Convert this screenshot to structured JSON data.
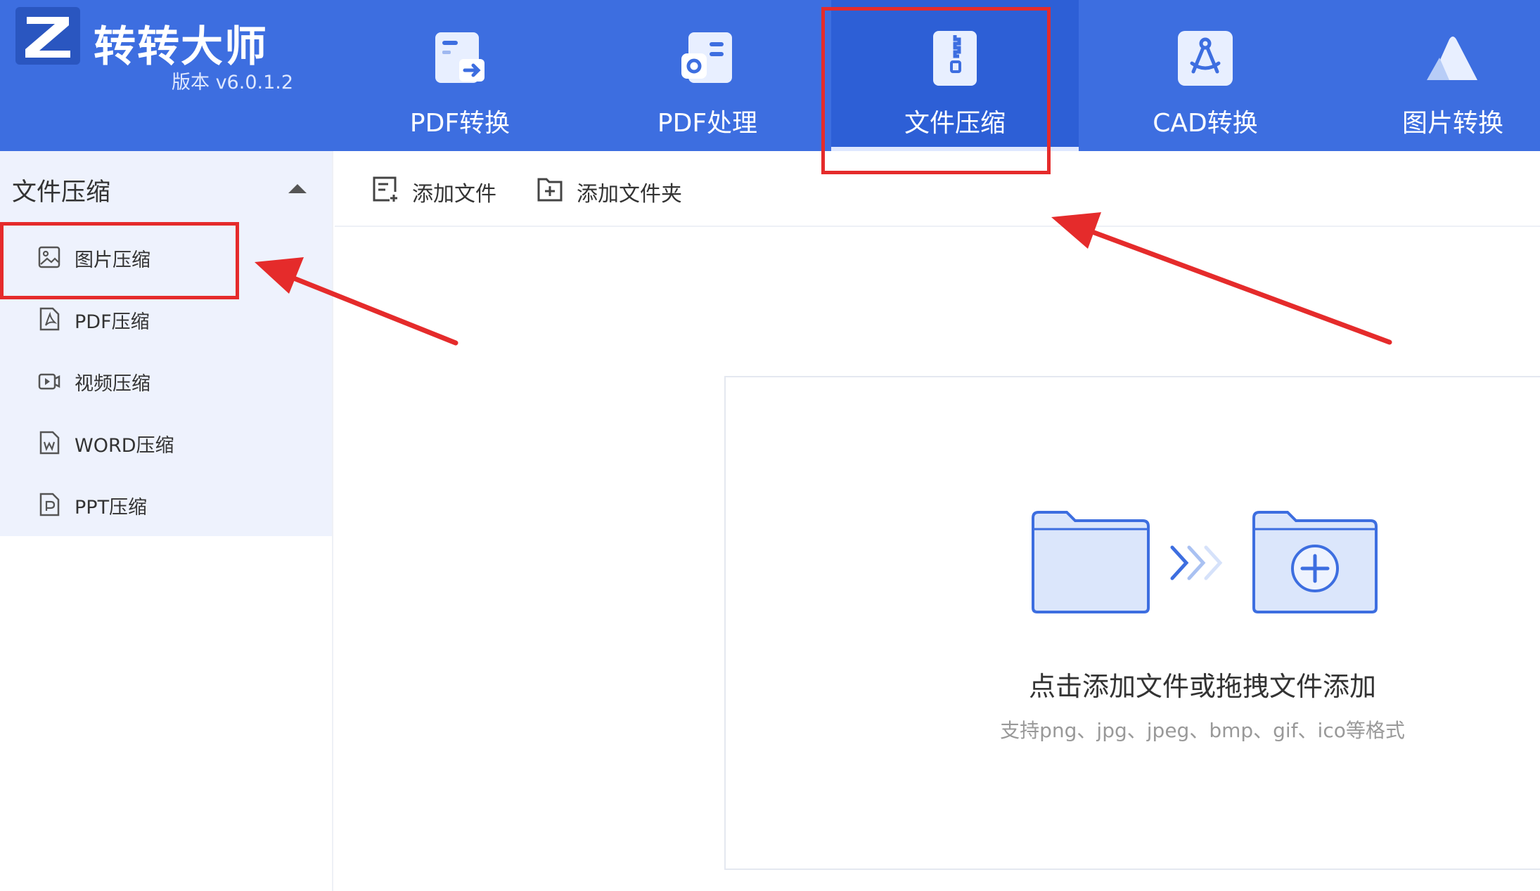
{
  "app": {
    "title": "转转大师",
    "version": "版本 v6.0.1.2"
  },
  "nav": {
    "tabs": [
      {
        "label": "PDF转换",
        "icon": "pdf-convert-icon"
      },
      {
        "label": "PDF处理",
        "icon": "pdf-process-icon"
      },
      {
        "label": "文件压缩",
        "icon": "zip-file-icon",
        "active": true
      },
      {
        "label": "CAD转换",
        "icon": "cad-compass-icon"
      },
      {
        "label": "图片转换",
        "icon": "mountain-image-icon"
      }
    ]
  },
  "sidebar": {
    "header": "文件压缩",
    "items": [
      {
        "label": "图片压缩",
        "icon": "image-icon",
        "selected": true
      },
      {
        "label": "PDF压缩",
        "icon": "pdf-file-icon"
      },
      {
        "label": "视频压缩",
        "icon": "video-icon"
      },
      {
        "label": "WORD压缩",
        "icon": "word-file-icon"
      },
      {
        "label": "PPT压缩",
        "icon": "ppt-file-icon"
      }
    ]
  },
  "toolbar": {
    "add_file": "添加文件",
    "add_folder": "添加文件夹"
  },
  "dropzone": {
    "title": "点击添加文件或拖拽文件添加",
    "subtitle": "支持png、jpg、jpeg、bmp、gif、ico等格式"
  },
  "colors": {
    "header_bg": "#3d6ee0",
    "active_tab_bg": "#2d5fd6",
    "sidebar_bg": "#eef2fd",
    "annotation_red": "#e52b2b",
    "folder_fill": "#dbe6fb",
    "folder_stroke": "#3d6ee0"
  }
}
